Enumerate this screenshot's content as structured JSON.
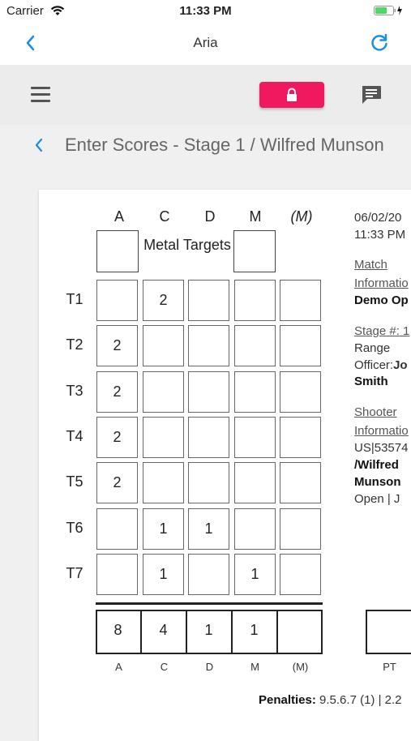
{
  "status_bar": {
    "carrier": "Carrier",
    "time": "11:33 PM"
  },
  "nav": {
    "title": "Aria"
  },
  "heading": {
    "text": "Enter Scores - Stage 1 / Wilfred Munson"
  },
  "grid": {
    "columns": [
      "A",
      "C",
      "D",
      "M",
      "(M)"
    ],
    "metal_label": "Metal Targets",
    "rows": [
      {
        "label": "T1",
        "cells": [
          "",
          "2",
          "",
          "",
          ""
        ]
      },
      {
        "label": "T2",
        "cells": [
          "2",
          "",
          "",
          "",
          ""
        ]
      },
      {
        "label": "T3",
        "cells": [
          "2",
          "",
          "",
          "",
          ""
        ]
      },
      {
        "label": "T4",
        "cells": [
          "2",
          "",
          "",
          "",
          ""
        ]
      },
      {
        "label": "T5",
        "cells": [
          "2",
          "",
          "",
          "",
          ""
        ]
      },
      {
        "label": "T6",
        "cells": [
          "",
          "1",
          "1",
          "",
          ""
        ]
      },
      {
        "label": "T7",
        "cells": [
          "",
          "1",
          "",
          "1",
          ""
        ]
      }
    ],
    "totals": [
      "8",
      "4",
      "1",
      "1",
      ""
    ],
    "total_labels": [
      "A",
      "C",
      "D",
      "M",
      "(M)"
    ],
    "pt_label": "PT"
  },
  "info": {
    "date": "06/02/20",
    "time": "11:33 PM",
    "match_label": "Match",
    "match_info_label": "Informatio",
    "match_name": "Demo Op",
    "stage_label": "Stage #: 1",
    "range": "Range",
    "officer_prefix": "Officer:",
    "officer_first": "Jo",
    "officer_last": "Smith",
    "shooter_label": "Shooter",
    "shooter_info_label": "Informatio",
    "shooter_id": "US|53574",
    "shooter_first": "/Wilfred",
    "shooter_last": "Munson",
    "division": "Open | J"
  },
  "penalties": {
    "label": "Penalties:",
    "value": " 9.5.6.7 (1) | 2.2"
  },
  "colors": {
    "accent": "#1a8fe3",
    "lock_button": "#f0185e"
  }
}
